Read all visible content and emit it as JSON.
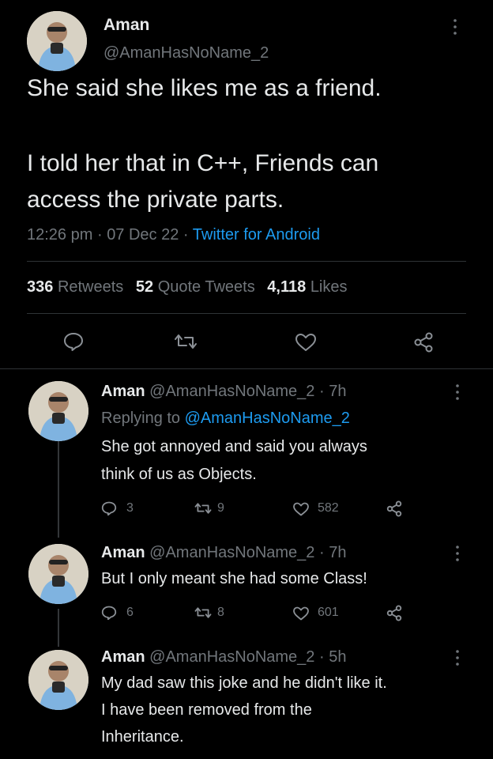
{
  "main_tweet": {
    "name": "Aman",
    "handle": "@AmanHasNoName_2",
    "text_line1": "She said she likes me as a friend.",
    "text_line2": "I told her that in C++, Friends can",
    "text_line3": "access the private parts.",
    "time": "12:26 pm",
    "date": "07 Dec 22",
    "source": "Twitter for Android",
    "sep": "·",
    "retweets_count": "336",
    "retweets_label": "Retweets",
    "quotes_count": "52",
    "quotes_label": "Quote Tweets",
    "likes_count": "4,118",
    "likes_label": "Likes"
  },
  "icons": {
    "more": "more-vertical-icon",
    "reply": "reply-bubble-icon",
    "retweet": "retweet-icon",
    "like": "heart-icon",
    "share": "share-icon"
  },
  "replies": [
    {
      "name": "Aman",
      "handle": "@AmanHasNoName_2",
      "age": "7h",
      "replying_prefix": "Replying to",
      "replying_to": "@AmanHasNoName_2",
      "text_line1": "She got annoyed and said you always",
      "text_line2": "think of us as Objects.",
      "reply_count": "3",
      "retweet_count": "9",
      "like_count": "582"
    },
    {
      "name": "Aman",
      "handle": "@AmanHasNoName_2",
      "age": "7h",
      "text_line1": "But I only meant she had some Class!",
      "reply_count": "6",
      "retweet_count": "8",
      "like_count": "601"
    },
    {
      "name": "Aman",
      "handle": "@AmanHasNoName_2",
      "age": "5h",
      "text_line1": "My dad saw this joke and he didn't like it.",
      "text_line2": "I have been removed from the",
      "text_line3": "Inheritance."
    }
  ]
}
